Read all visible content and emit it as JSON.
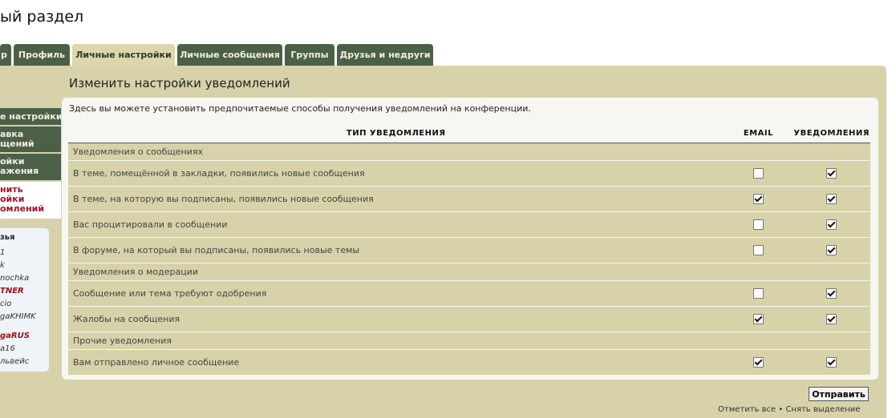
{
  "page_title": "ый раздел",
  "tabs": [
    {
      "label": "р",
      "active": false
    },
    {
      "label": "Профиль",
      "active": false
    },
    {
      "label": "Личные настройки",
      "active": true
    },
    {
      "label": "Личные сообщения",
      "active": false
    },
    {
      "label": "Группы",
      "active": false
    },
    {
      "label": "Друзья и недруги",
      "active": false
    }
  ],
  "sidebar": {
    "items": [
      {
        "label": "е настройки"
      },
      {
        "label": "авка\nщений"
      },
      {
        "label": "ойки\nажения"
      }
    ],
    "current": "нить\nойки\nомлений"
  },
  "friends": {
    "heading": "зья",
    "entries": [
      "1",
      "k",
      "nochka",
      "TNER",
      "cio",
      "gaKHIMK",
      "gaRUS",
      "a16",
      "львейс"
    ]
  },
  "section_title": "Изменить настройки уведомлений",
  "description": "Здесь вы можете установить предпочитаемые способы получения уведомлений на конференции.",
  "table": {
    "headers": {
      "type": "ТИП УВЕДОМЛЕНИЯ",
      "email": "EMAIL",
      "notify": "УВЕДОМЛЕНИЯ"
    },
    "groups": [
      {
        "title": "Уведомления о сообщениях",
        "rows": [
          {
            "label": "В теме, помещённой в закладки, появились новые сообщения",
            "email": false,
            "notify": true
          },
          {
            "label": "В теме, на которую вы подписаны, появились новые сообщения",
            "email": true,
            "notify": true
          },
          {
            "label": "Вас процитировали в сообщении",
            "email": false,
            "notify": true
          },
          {
            "label": "В форуме, на который вы подписаны, появились новые темы",
            "email": false,
            "notify": true
          }
        ]
      },
      {
        "title": "Уведомления о модерации",
        "rows": [
          {
            "label": "Сообщение или тема требуют одобрения",
            "email": false,
            "notify": true
          },
          {
            "label": "Жалобы на сообщения",
            "email": true,
            "notify": true
          }
        ]
      },
      {
        "title": "Прочие уведомления",
        "rows": [
          {
            "label": "Вам отправлено личное сообщение",
            "email": true,
            "notify": true
          }
        ]
      }
    ]
  },
  "submit_label": "Отправить",
  "footer": {
    "mark_all": "Отметить все",
    "separator": " • ",
    "unmark_all": "Снять выделение"
  }
}
